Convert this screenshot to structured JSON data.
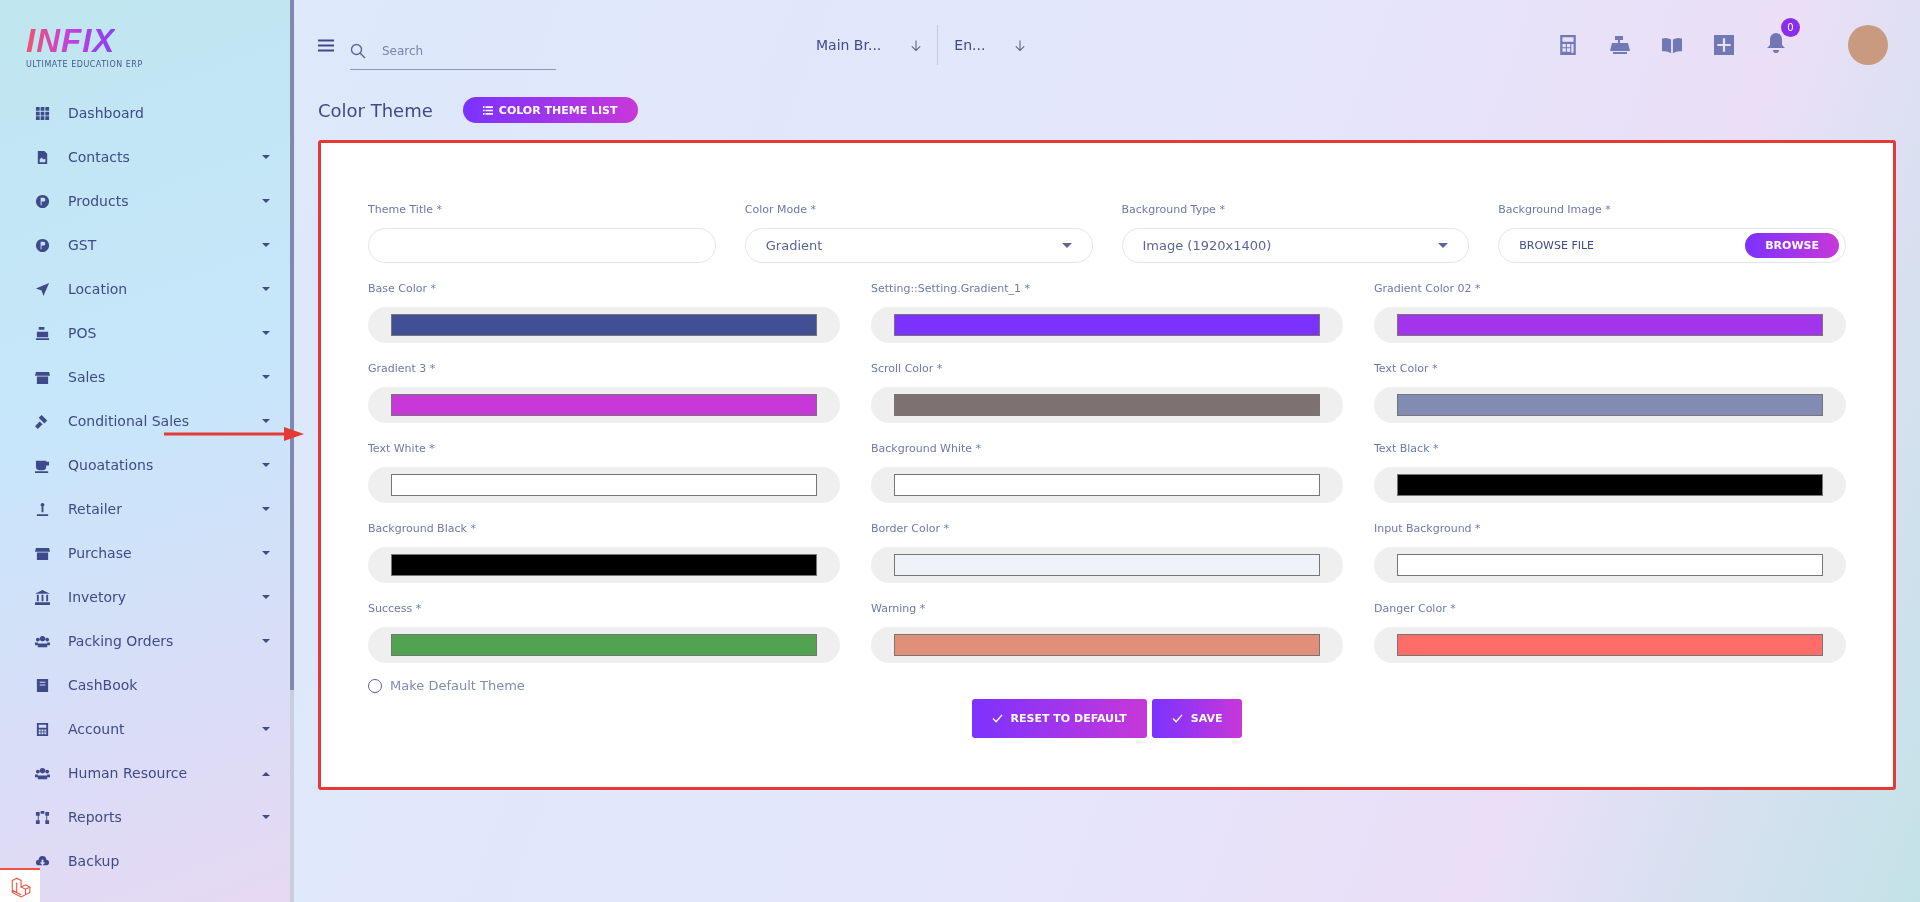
{
  "logo": {
    "name": "INFIX",
    "tagline": "ULTIMATE EDUCATION ERP"
  },
  "sidebar": {
    "items": [
      {
        "label": "Dashboard",
        "kind": "link"
      },
      {
        "label": "Contacts",
        "kind": "menu",
        "expanded": false
      },
      {
        "label": "Products",
        "kind": "menu",
        "expanded": false
      },
      {
        "label": "GST",
        "kind": "menu",
        "expanded": false
      },
      {
        "label": "Location",
        "kind": "menu",
        "expanded": false
      },
      {
        "label": "POS",
        "kind": "menu",
        "expanded": false
      },
      {
        "label": "Sales",
        "kind": "menu",
        "expanded": false
      },
      {
        "label": "Conditional Sales",
        "kind": "menu",
        "expanded": false
      },
      {
        "label": "Quoatations",
        "kind": "menu",
        "expanded": false
      },
      {
        "label": "Retailer",
        "kind": "menu",
        "expanded": false
      },
      {
        "label": "Purchase",
        "kind": "menu",
        "expanded": false
      },
      {
        "label": "Invetory",
        "kind": "menu",
        "expanded": false
      },
      {
        "label": "Packing Orders",
        "kind": "menu",
        "expanded": false
      },
      {
        "label": "CashBook",
        "kind": "link"
      },
      {
        "label": "Account",
        "kind": "menu",
        "expanded": false
      },
      {
        "label": "Human Resource",
        "kind": "menu",
        "expanded": true
      },
      {
        "label": "Reports",
        "kind": "menu",
        "expanded": false
      },
      {
        "label": "Backup",
        "kind": "link"
      }
    ]
  },
  "header": {
    "search": {
      "placeholder": "Search"
    },
    "branch": "Main Br...",
    "language": "En...",
    "notifications": "0"
  },
  "page": {
    "title": "Color Theme",
    "list_button": "COLOR THEME LIST"
  },
  "form": {
    "theme_title": {
      "label": "Theme Title *"
    },
    "color_mode": {
      "label": "Color Mode *",
      "value": "Gradient"
    },
    "background_type": {
      "label": "Background Type *",
      "value": "Image (1920x1400)"
    },
    "background_image": {
      "label": "Background Image *",
      "file": "BROWSE FILE",
      "button": "BROWSE"
    },
    "colors": [
      {
        "label": "Base Color *",
        "color": "#415094"
      },
      {
        "label": "Setting::Setting.Gradient_1 *",
        "color": "#7c32ff"
      },
      {
        "label": "Gradient Color 02 *",
        "color": "#a235ec"
      },
      {
        "label": "Gradient 3 *",
        "color": "#c738d8"
      },
      {
        "label": "Scroll Color *",
        "color": "#7e7172"
      },
      {
        "label": "Text Color *",
        "color": "#828bb2"
      },
      {
        "label": "Text White *",
        "color": "#ffffff"
      },
      {
        "label": "Background White *",
        "color": "#ffffff"
      },
      {
        "label": "Text Black *",
        "color": "#000000"
      },
      {
        "label": "Background Black *",
        "color": "#000000"
      },
      {
        "label": "Border Color *",
        "color": "#eff2f8"
      },
      {
        "label": "Input Background *",
        "color": "#ffffff"
      },
      {
        "label": "Success *",
        "color": "#51a351"
      },
      {
        "label": "Warning *",
        "color": "#e09079"
      },
      {
        "label": "Danger Color *",
        "color": "#ff6d68"
      }
    ],
    "make_default": {
      "label": "Make Default Theme",
      "checked": false
    },
    "buttons": [
      {
        "label": "RESET TO DEFAULT"
      },
      {
        "label": "SAVE"
      }
    ]
  }
}
